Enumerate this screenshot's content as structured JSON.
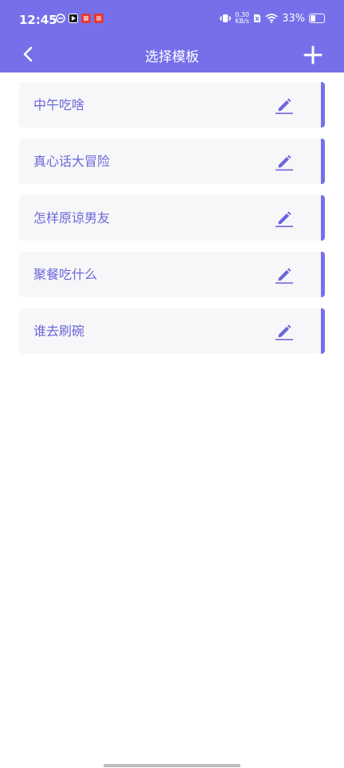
{
  "status_bar": {
    "time": "12:45",
    "net_speed_value": "0.30",
    "net_speed_unit": "KB/s",
    "battery_percent": "33%",
    "battery_level": 0.33
  },
  "header": {
    "title": "选择模板",
    "back_icon": "chevron-left-icon",
    "add_icon": "plus-icon"
  },
  "templates": [
    {
      "label": "中午吃啥"
    },
    {
      "label": "真心话大冒险"
    },
    {
      "label": "怎样原谅男友"
    },
    {
      "label": "聚餐吃什么"
    },
    {
      "label": "谁去刷碗"
    }
  ],
  "colors": {
    "accent": "#7570ea",
    "item_text": "#6b66d8",
    "item_bg": "#f7f7f9"
  }
}
